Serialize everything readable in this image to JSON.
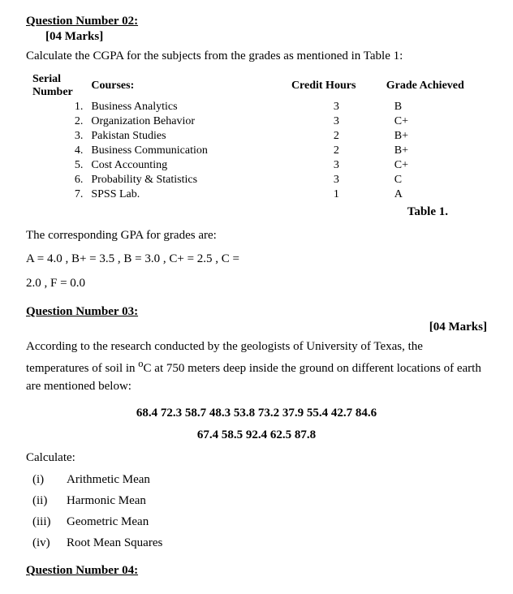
{
  "q2": {
    "header": "Question Number 02:",
    "marks": "[04 Marks]",
    "description": "Calculate the CGPA for the subjects from the grades as mentioned in Table 1:",
    "table_caption": "Table 1.",
    "table_headers": {
      "serial": "Serial Number",
      "course": "Courses:",
      "credit": "Credit Hours",
      "grade": "Grade Achieved"
    },
    "rows": [
      {
        "sn": "1.",
        "course": "Business Analytics",
        "credit": "3",
        "grade": "B"
      },
      {
        "sn": "2.",
        "course": "Organization Behavior",
        "credit": "3",
        "grade": "C+"
      },
      {
        "sn": "3.",
        "course": "Pakistan Studies",
        "credit": "2",
        "grade": "B+"
      },
      {
        "sn": "4.",
        "course": "Business Communication",
        "credit": "2",
        "grade": "B+"
      },
      {
        "sn": "5.",
        "course": "Cost Accounting",
        "credit": "3",
        "grade": "C+"
      },
      {
        "sn": "6.",
        "course": "Probability & Statistics",
        "credit": "3",
        "grade": "C"
      },
      {
        "sn": "7.",
        "course": "SPSS Lab.",
        "credit": "1",
        "grade": "A"
      }
    ],
    "gpa_intro": "The corresponding GPA for grades are:",
    "gpa_values": "A  =  4.0  ,   B+  =  3.5  ,      B = 3.0  ,     C+  =  2.5  ,   C =",
    "gpa_values2": " 2.0 ,    F = 0.0"
  },
  "q3": {
    "header": "Question Number 03:",
    "marks": "[04 Marks]",
    "description_1": "According to the research conducted by the geologists of University of Texas, the temperatures of soil in ",
    "degree": "o",
    "description_2": "C at 750 meters deep inside the ground on different locations of earth are mentioned below:",
    "temperatures_line1": "68.4  72.3  58.7  48.3  53.8  73.2  37.9  55.4  42.7  84.6",
    "temperatures_line2": "67.4  58.5  92.4  62.5  87.8",
    "calculate_label": "Calculate:",
    "calc_items": [
      {
        "num": "(i)",
        "label": "Arithmetic Mean"
      },
      {
        "num": "(ii)",
        "label": "Harmonic Mean"
      },
      {
        "num": "(iii)",
        "label": "Geometric Mean"
      },
      {
        "num": "(iv)",
        "label": "Root Mean Squares"
      }
    ]
  },
  "q4_partial": {
    "header": "Question Number 04:"
  }
}
